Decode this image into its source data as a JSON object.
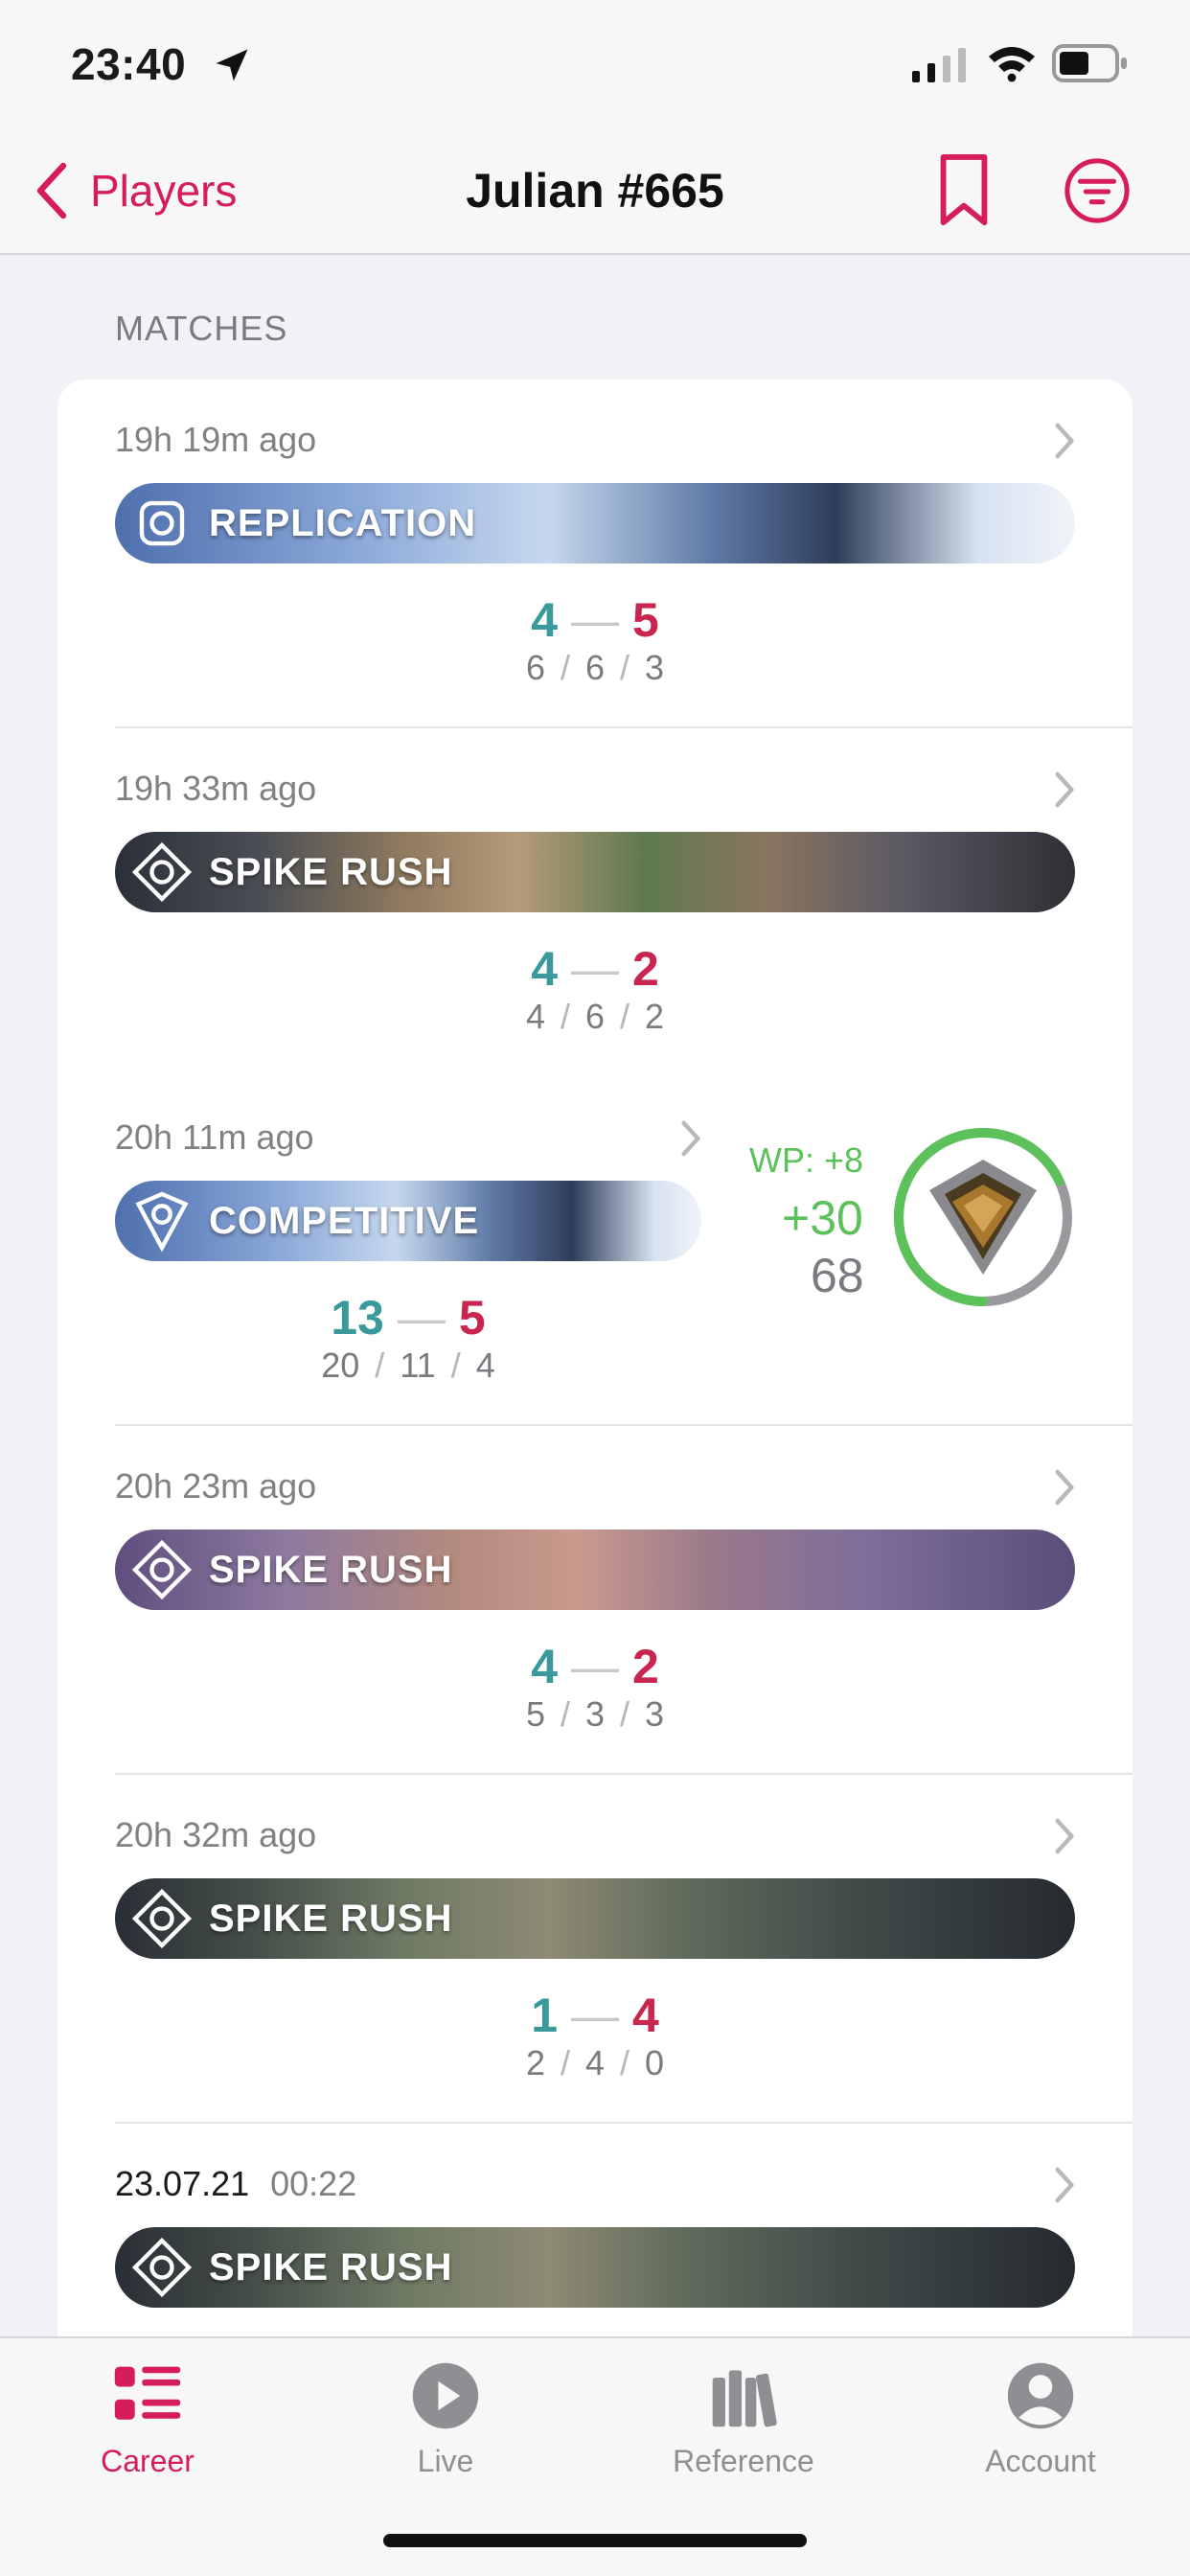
{
  "status_bar": {
    "time": "23:40"
  },
  "nav": {
    "back_label": "Players",
    "title": "Julian #665"
  },
  "section_header": "MATCHES",
  "colors": {
    "accent": "#d61d5c",
    "ally": "#3a9a9b",
    "enemy": "#c8264f",
    "gain": "#5cc15a"
  },
  "matches": [
    {
      "time": "19h 19m ago",
      "mode": "REPLICATION",
      "mode_icon": "replication-mode-icon",
      "score_a": "4",
      "score_b": "5",
      "kills": "6",
      "deaths": "6",
      "assists": "3"
    },
    {
      "time": "19h 33m ago",
      "mode": "SPIKE RUSH",
      "mode_icon": "spike-rush-mode-icon",
      "score_a": "4",
      "score_b": "2",
      "kills": "4",
      "deaths": "6",
      "assists": "2"
    },
    {
      "time": "20h 11m ago",
      "mode": "COMPETITIVE",
      "mode_icon": "competitive-mode-icon",
      "score_a": "13",
      "score_b": "5",
      "kills": "20",
      "deaths": "11",
      "assists": "4",
      "wp": "WP: +8",
      "rr_gain": "+30",
      "rr_total": "68",
      "rank_progress": 0.68
    },
    {
      "time": "20h 23m ago",
      "mode": "SPIKE RUSH",
      "mode_icon": "spike-rush-mode-icon",
      "score_a": "4",
      "score_b": "2",
      "kills": "5",
      "deaths": "3",
      "assists": "3"
    },
    {
      "time": "20h 32m ago",
      "mode": "SPIKE RUSH",
      "mode_icon": "spike-rush-mode-icon",
      "score_a": "1",
      "score_b": "4",
      "kills": "2",
      "deaths": "4",
      "assists": "0"
    },
    {
      "date": "23.07.21",
      "clock": "00:22",
      "mode": "SPIKE RUSH",
      "mode_icon": "spike-rush-mode-icon"
    }
  ],
  "tabs": [
    {
      "label": "Career",
      "icon": "career-list-icon",
      "active": true
    },
    {
      "label": "Live",
      "icon": "play-icon"
    },
    {
      "label": "Reference",
      "icon": "books-icon"
    },
    {
      "label": "Account",
      "icon": "person-icon"
    }
  ]
}
